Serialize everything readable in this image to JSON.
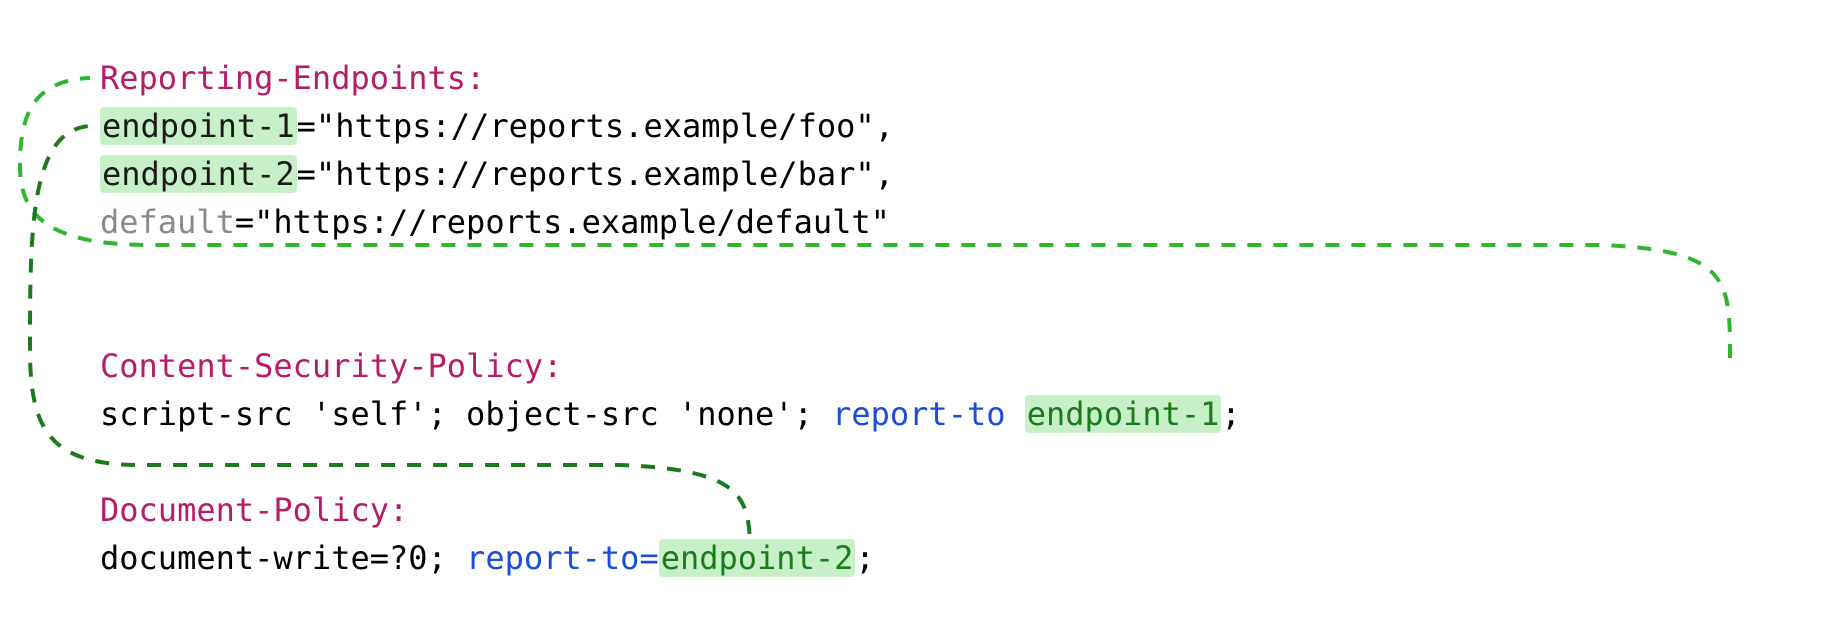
{
  "headers": {
    "reporting_endpoints": "Reporting-Endpoints:",
    "csp": "Content-Security-Policy:",
    "doc_policy": "Document-Policy:"
  },
  "endpoints": {
    "e1_name": "endpoint-1",
    "e1_url": "=\"https://reports.example/foo\",",
    "e2_name": "endpoint-2",
    "e2_url": "=\"https://reports.example/bar\",",
    "default_name": "default",
    "default_url": "=\"https://reports.example/default\""
  },
  "csp": {
    "directives": "script-src 'self'; object-src 'none'; ",
    "report_to_kw": "report-to ",
    "target": "endpoint-1",
    "semi": ";"
  },
  "doc": {
    "directives": "document-write=?0; ",
    "report_to_kw": "report-to=",
    "target": "endpoint-2",
    "semi": ";"
  },
  "arrow_colors": {
    "light": "#2fb62f",
    "dark": "#1b7a1b"
  }
}
